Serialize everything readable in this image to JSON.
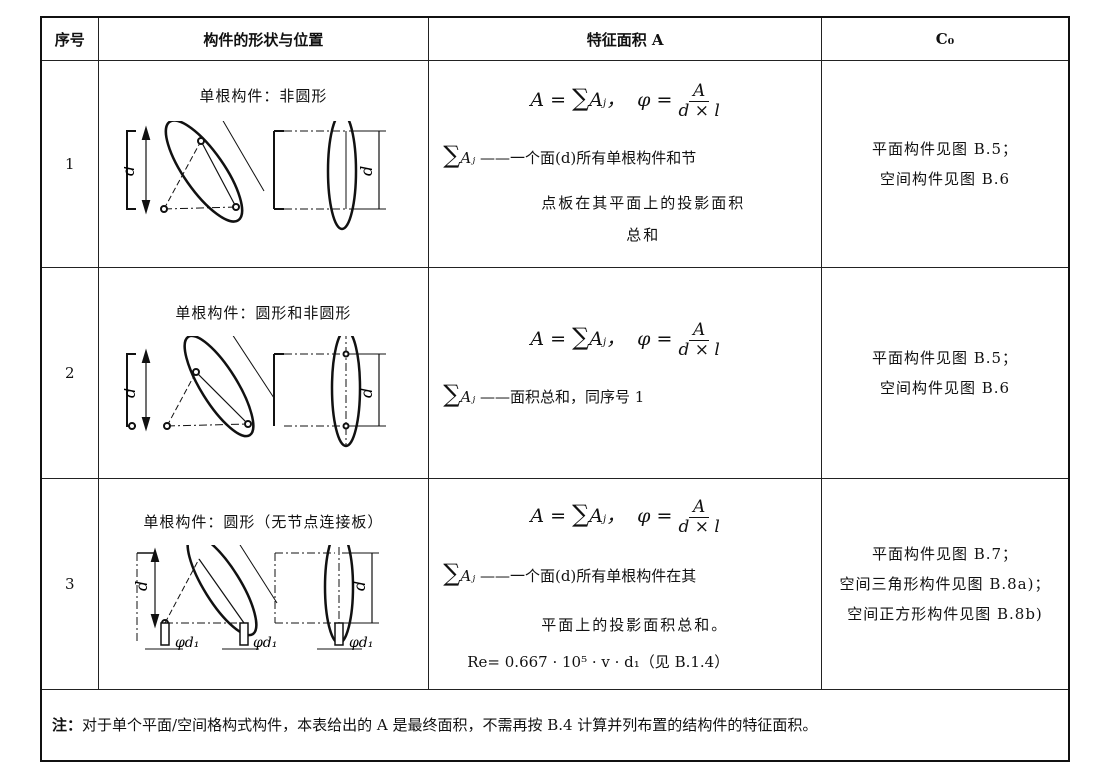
{
  "headers": [
    "序号",
    "构件的形状与位置",
    "特征面积 A",
    "C₀"
  ],
  "rows": [
    {
      "index": "1",
      "shape_title": "单根构件：非圆形",
      "formula_main": "A = ΣAⱼ，  φ = A / (d × l)",
      "sigma_label": "Aⱼ",
      "desc_line1": "——一个面(d)所有单根构件和节",
      "desc_cont": [
        "点板在其平面上的投影面积",
        "总和"
      ],
      "c0": [
        "平面构件见图 B.5；",
        "空间构件见图 B.6"
      ]
    },
    {
      "index": "2",
      "shape_title": "单根构件：圆形和非圆形",
      "formula_main": "A = ΣAⱼ，  φ = A / (d × l)",
      "sigma_label": "Aⱼ",
      "desc_line1": "——面积总和，同序号 1",
      "c0": [
        "平面构件见图 B.5；",
        "空间构件见图 B.6"
      ]
    },
    {
      "index": "3",
      "shape_title": "单根构件：圆形（无节点连接板）",
      "formula_main": "A = ΣAⱼ，  φ = A / (d × l)",
      "sigma_label": "Aⱼ",
      "desc_line1": "——一个面(d)所有单根构件在其",
      "desc_cont": [
        "平面上的投影面积总和。"
      ],
      "re_formula": "Re= 0.667 · 10⁵ · v · d₁（见 B.1.4）",
      "c0": [
        "平面构件见图 B.7；",
        "空间三角形构件见图 B.8a)；",
        "空间正方形构件见图 B.8b)"
      ]
    }
  ],
  "note_label": "注：",
  "note_text": "对于单个平面/空间格构式构件，本表给出的 A 是最终面积，不需再按 B.4 计算并列布置的结构件的特征面积。",
  "fig_labels": {
    "d": "d",
    "phi_d1": "φd₁",
    "frac_num": "A",
    "frac_den": "d × l"
  }
}
